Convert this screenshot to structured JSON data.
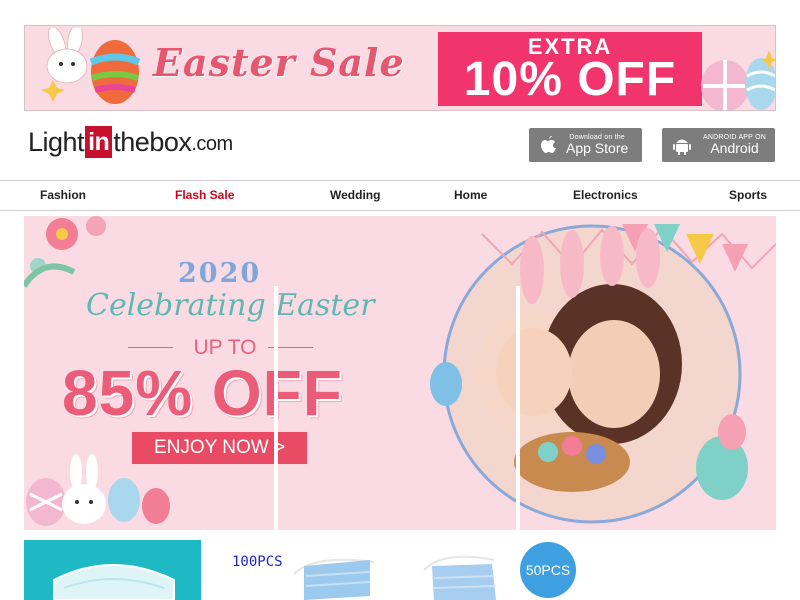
{
  "banner": {
    "title": "Easter Sale",
    "extra": "EXTRA",
    "offer": "10% OFF"
  },
  "header": {
    "logo_light": "Light",
    "logo_in": "in",
    "logo_thebox": "thebox",
    "logo_com": ".com",
    "appstore_small": "Download on the",
    "appstore_big": "App Store",
    "android_small": "ANDROID APP ON",
    "android_big": "Android"
  },
  "nav": {
    "items": [
      "Fashion",
      "Flash Sale",
      "Wedding",
      "Home",
      "Electronics",
      "Sports"
    ]
  },
  "hero": {
    "year": "2020",
    "headline": "Celebrating Easter",
    "upto": "UP TO",
    "discount": "85% OFF",
    "cta": "ENJOY NOW >"
  },
  "products": {
    "pack_100": "100PCS",
    "pack_50": "50PCS"
  },
  "colors": {
    "brand_red": "#c8102e",
    "pink_bg": "#fbdbe3",
    "sale_pink": "#f2346c",
    "teal": "#1fb9c6"
  }
}
